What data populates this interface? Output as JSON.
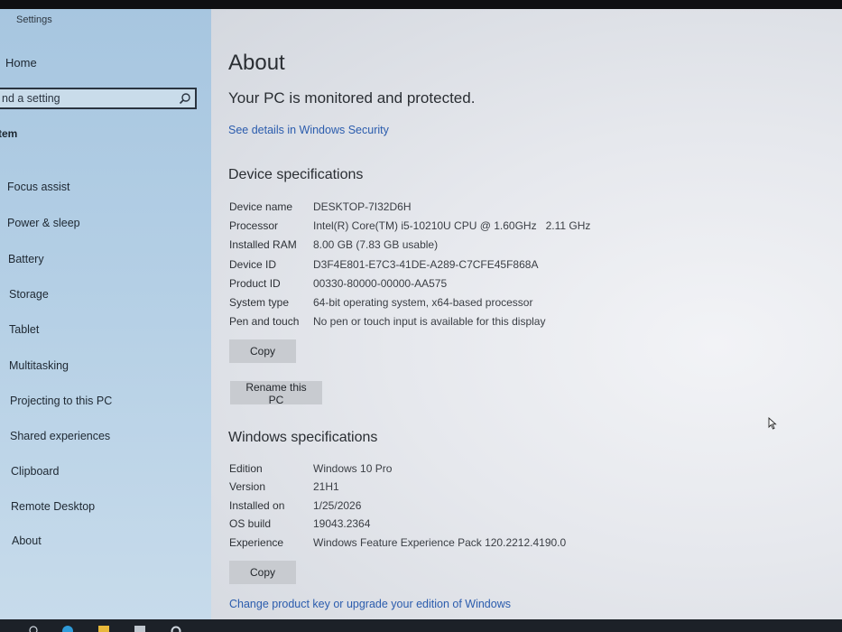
{
  "window": {
    "app_title": "Settings"
  },
  "sidebar": {
    "home_label": "Home",
    "search_placeholder": "nd a setting",
    "section_label": "tem",
    "items": [
      "Focus assist",
      "Power & sleep",
      "Battery",
      "Storage",
      "Tablet",
      "Multitasking",
      "Projecting to this PC",
      "Shared experiences",
      "Clipboard",
      "Remote Desktop",
      "About"
    ]
  },
  "main": {
    "title": "About",
    "protection_status": "Your PC is monitored and protected.",
    "security_link": "See details in Windows Security",
    "device_spec_heading": "Device specifications",
    "device_specs": [
      {
        "label": "Device name",
        "value": "DESKTOP-7I32D6H"
      },
      {
        "label": "Processor",
        "value": "Intel(R) Core(TM) i5-10210U CPU @ 1.60GHz   2.11 GHz"
      },
      {
        "label": "Installed RAM",
        "value": "8.00 GB (7.83 GB usable)"
      },
      {
        "label": "Device ID",
        "value": "D3F4E801-E7C3-41DE-A289-C7CFE45F868A"
      },
      {
        "label": "Product ID",
        "value": "00330-80000-00000-AA575"
      },
      {
        "label": "System type",
        "value": "64-bit operating system, x64-based processor"
      },
      {
        "label": "Pen and touch",
        "value": "No pen or touch input is available for this display"
      }
    ],
    "copy_label": "Copy",
    "rename_label": "Rename this PC",
    "windows_spec_heading": "Windows specifications",
    "windows_specs": [
      {
        "label": "Edition",
        "value": "Windows 10 Pro"
      },
      {
        "label": "Version",
        "value": "21H1"
      },
      {
        "label": "Installed on",
        "value": "1/25/2026"
      },
      {
        "label": "OS build",
        "value": "19043.2364"
      },
      {
        "label": "Experience",
        "value": "Windows Feature Experience Pack 120.2212.4190.0"
      }
    ],
    "copy_label_2": "Copy",
    "product_key_link": "Change product key or upgrade your edition of Windows"
  },
  "icons": {
    "search": "search-icon",
    "home": "home-icon",
    "cursor": "mouse-cursor-icon"
  },
  "colors": {
    "sidebar_bg": "#b4cfe5",
    "link": "#2b5cad",
    "button_bg": "#c8cbd0"
  }
}
